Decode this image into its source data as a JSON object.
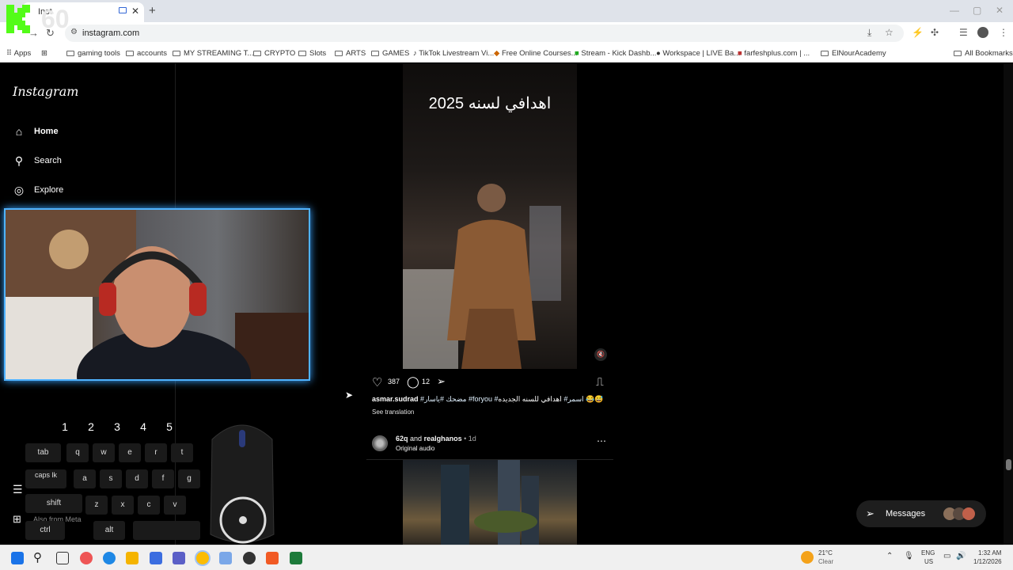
{
  "browser": {
    "tab_title": "Inst",
    "url": "instagram.com",
    "bookmarks": [
      "Apps",
      "gaming tools",
      "accounts",
      "MY STREAMING T...",
      "CRYPTO",
      "Slots",
      "ARTS",
      "GAMES",
      "TikTok Livestream Vi...",
      "Free Online Courses...",
      "Stream - Kick Dashb...",
      "Workspace | LIVE Ba...",
      "farfeshplus.com | ...",
      "ElNourAcademy",
      "All Bookmarks"
    ]
  },
  "sidebar": {
    "logo": "Instagram",
    "items": [
      {
        "label": "Home",
        "icon": "home-icon"
      },
      {
        "label": "Search",
        "icon": "search-icon"
      },
      {
        "label": "Explore",
        "icon": "explore-icon"
      }
    ],
    "partial_label": "Also from Meta"
  },
  "post1": {
    "overlay_text": "اهدافي لسنه 2025",
    "likes": "387",
    "comments": "12",
    "username": "asmar.sudrad",
    "caption_text": "اهدافي للسنه الجديده 😂😅",
    "hashtags": "#مضحك #ياسار #foryou #اسمر#",
    "see_translation": "See translation"
  },
  "post2": {
    "user_a": "62q",
    "and": "and",
    "user_b": "realghanos",
    "time": "• 1d",
    "audio": "Original audio"
  },
  "messages": {
    "label": "Messages"
  },
  "overlay": {
    "kick_counter": "60",
    "keys_row1": [
      "1",
      "2",
      "3",
      "4",
      "5"
    ],
    "keys_row2": [
      "tab",
      "q",
      "w",
      "e",
      "r",
      "t"
    ],
    "keys_row3": [
      "caps lk",
      "a",
      "s",
      "d",
      "f",
      "g"
    ],
    "keys_row4": [
      "shift",
      "z",
      "x",
      "c",
      "v"
    ],
    "keys_row5": [
      "ctrl",
      "alt"
    ]
  },
  "taskbar": {
    "weather_temp": "21°C",
    "weather_desc": "Clear",
    "lang_top": "ENG",
    "lang_bottom": "US",
    "time": "1:32 AM",
    "date": "1/12/2026"
  },
  "colors": {
    "accent_blue": "#4fb3ff",
    "link_blue": "#e0f1ff",
    "kick_green": "#53fc18"
  }
}
